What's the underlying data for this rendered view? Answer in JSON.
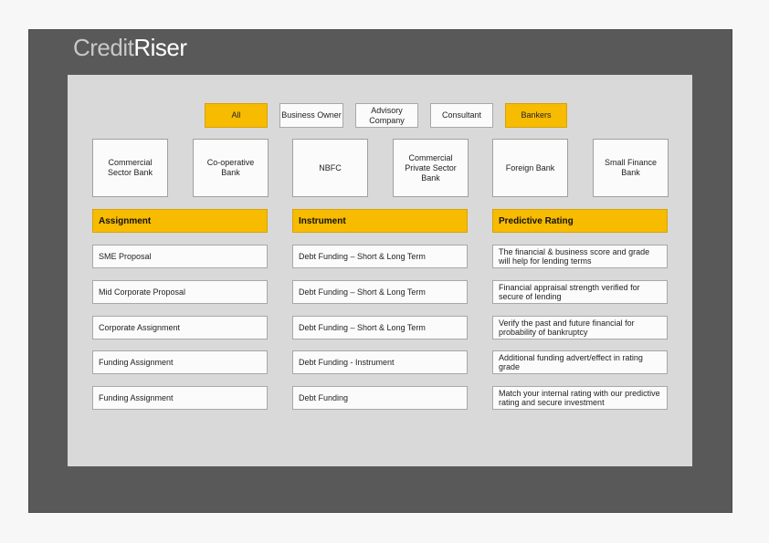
{
  "brand": {
    "part1": "Credit",
    "part2": "Riser"
  },
  "filters": [
    {
      "label": "All",
      "active": true
    },
    {
      "label": "Business Owner",
      "active": false
    },
    {
      "label": "Advisory Company",
      "active": false
    },
    {
      "label": "Consultant",
      "active": false
    },
    {
      "label": "Bankers",
      "active": true
    }
  ],
  "banks": [
    "Commercial Sector Bank",
    "Co-operative Bank",
    "NBFC",
    "Commercial Private Sector Bank",
    "Foreign Bank",
    "Small Finance Bank"
  ],
  "columns": [
    {
      "title": "Assignment",
      "items": [
        "SME Proposal",
        "Mid Corporate Proposal",
        "Corporate Assignment",
        "Funding Assignment",
        "Funding Assignment"
      ]
    },
    {
      "title": "Instrument",
      "items": [
        "Debt Funding – Short & Long Term",
        "Debt Funding – Short & Long Term",
        "Debt Funding –  Short & Long Term",
        "Debt Funding -  Instrument",
        "Debt Funding"
      ]
    },
    {
      "title": "Predictive Rating",
      "items": [
        "The financial & business score and grade will help for lending terms",
        "Financial appraisal strength verified for secure of lending",
        "Verify the past and future financial for probability of bankruptcy",
        "Additional funding advert/effect in rating grade",
        "Match your internal rating with our predictive rating and secure investment"
      ]
    }
  ],
  "colors": {
    "accent": "#f7bb00",
    "frame": "#595959",
    "panel": "#d9d9d9"
  }
}
